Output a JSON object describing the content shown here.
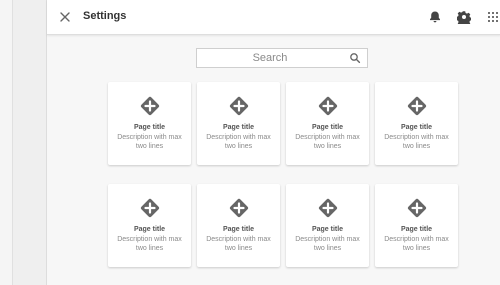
{
  "window": {
    "title": "Settings"
  },
  "search": {
    "placeholder": "Search"
  },
  "header_icons": [
    {
      "name": "bell-icon"
    },
    {
      "name": "settings-icon"
    },
    {
      "name": "apps-grid-icon"
    }
  ],
  "cards": [
    {
      "title": "Page title",
      "description": "Description with max two lines",
      "icon": "add-diamond-icon"
    },
    {
      "title": "Page title",
      "description": "Description with max two lines",
      "icon": "add-diamond-icon"
    },
    {
      "title": "Page title",
      "description": "Description with max two lines",
      "icon": "add-diamond-icon"
    },
    {
      "title": "Page title",
      "description": "Description with max two lines",
      "icon": "add-diamond-icon"
    },
    {
      "title": "Page title",
      "description": "Description with max two lines",
      "icon": "add-diamond-icon"
    },
    {
      "title": "Page title",
      "description": "Description with max two lines",
      "icon": "add-diamond-icon"
    },
    {
      "title": "Page title",
      "description": "Description with max two lines",
      "icon": "add-diamond-icon"
    },
    {
      "title": "Page title",
      "description": "Description with max two lines",
      "icon": "add-diamond-icon"
    }
  ],
  "colors": {
    "background": "#efefef",
    "panel": "#f7f7f7",
    "card": "#ffffff",
    "icon": "#666666",
    "text_primary": "#333333",
    "text_secondary": "#8a8a8a"
  }
}
